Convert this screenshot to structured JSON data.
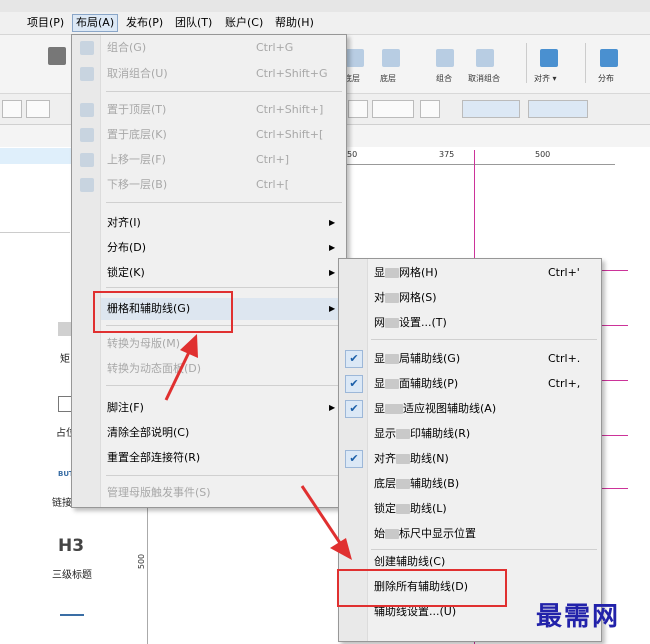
{
  "colors": {
    "accent_red": "#e03030",
    "guide": "#cc3399",
    "watermark": "#2222aa",
    "selection": "#dfeffb"
  },
  "menubar": {
    "items": [
      {
        "label": "项目(P)"
      },
      {
        "label": "布局(A)"
      },
      {
        "label": "发布(P)"
      },
      {
        "label": "团队(T)"
      },
      {
        "label": "账户(C)"
      },
      {
        "label": "帮助(H)"
      }
    ]
  },
  "toolbar": {
    "labels": [
      "底层",
      "底层",
      "组合",
      "取消组合",
      "对齐 ▾",
      "分布"
    ]
  },
  "ruler": {
    "ticks": [
      "50",
      "375",
      "500"
    ]
  },
  "vruler": {
    "tick": "500"
  },
  "left_panel": {
    "items": [
      {
        "label": "矩"
      },
      {
        "label": "占位"
      },
      {
        "label": "BUT"
      },
      {
        "label": "链接"
      },
      {
        "label": "H3"
      },
      {
        "label": "三级标题"
      }
    ]
  },
  "layout_menu": {
    "items": [
      {
        "label": "组合(G)",
        "shortcut": "Ctrl+G",
        "enabled": false,
        "icon": "group-icon"
      },
      {
        "label": "取消组合(U)",
        "shortcut": "Ctrl+Shift+G",
        "enabled": false,
        "icon": "ungroup-icon"
      },
      {
        "label": "置于顶层(T)",
        "shortcut": "Ctrl+Shift+]",
        "enabled": false,
        "icon": "bring-front-icon"
      },
      {
        "label": "置于底层(K)",
        "shortcut": "Ctrl+Shift+[",
        "enabled": false,
        "icon": "send-back-icon"
      },
      {
        "label": "上移一层(F)",
        "shortcut": "Ctrl+]",
        "enabled": false,
        "icon": "forward-icon"
      },
      {
        "label": "下移一层(B)",
        "shortcut": "Ctrl+[",
        "enabled": false,
        "icon": "backward-icon"
      },
      {
        "label": "对齐(I)",
        "shortcut": "",
        "enabled": true,
        "submenu": true
      },
      {
        "label": "分布(D)",
        "shortcut": "",
        "enabled": true,
        "submenu": true
      },
      {
        "label": "锁定(K)",
        "shortcut": "",
        "enabled": true,
        "submenu": true
      },
      {
        "label": "栅格和辅助线(G)",
        "shortcut": "",
        "enabled": true,
        "submenu": true
      },
      {
        "label": "转换为母版(M)",
        "shortcut": "",
        "enabled": false
      },
      {
        "label": "转换为动态面板(D)",
        "shortcut": "",
        "enabled": false
      },
      {
        "label": "脚注(F)",
        "shortcut": "",
        "enabled": true,
        "submenu": true
      },
      {
        "label": "清除全部说明(C)",
        "shortcut": "",
        "enabled": true
      },
      {
        "label": "重置全部连接符(R)",
        "shortcut": "",
        "enabled": true
      },
      {
        "label": "管理母版触发事件(S)",
        "shortcut": "",
        "enabled": false
      }
    ]
  },
  "grid_menu": {
    "items": [
      {
        "pre": "显",
        "post": "网格(H)",
        "shortcut": "Ctrl+'",
        "checked": false
      },
      {
        "pre": "对",
        "post": "网格(S)",
        "shortcut": "",
        "checked": false
      },
      {
        "pre": "网",
        "post": "设置...(T)",
        "shortcut": "",
        "checked": false
      },
      {
        "pre": "显",
        "post": "局辅助线(G)",
        "shortcut": "Ctrl+.",
        "checked": true
      },
      {
        "pre": "显",
        "post": "面辅助线(P)",
        "shortcut": "Ctrl+,",
        "checked": true
      },
      {
        "pre": "显",
        "post": "适应视图辅助线(A)",
        "shortcut": "",
        "checked": true
      },
      {
        "pre": "显示",
        "post": "印辅助线(R)",
        "shortcut": "",
        "checked": false
      },
      {
        "pre": "对齐",
        "post": "助线(N)",
        "shortcut": "",
        "checked": true
      },
      {
        "pre": "底层",
        "post": "辅助线(B)",
        "shortcut": "",
        "checked": false
      },
      {
        "pre": "锁定",
        "post": "助线(L)",
        "shortcut": "",
        "checked": false
      },
      {
        "pre": "始",
        "post": "标尺中显示位置",
        "shortcut": "",
        "checked": false
      },
      {
        "pre": "创建辅助线(C)",
        "post": "",
        "shortcut": "",
        "checked": false
      },
      {
        "pre": "删除所有辅助线(D)",
        "post": "",
        "shortcut": "",
        "checked": false
      },
      {
        "pre": "辅助线设置...(U)",
        "post": "",
        "shortcut": "",
        "checked": false
      }
    ]
  },
  "watermark": "最需网"
}
